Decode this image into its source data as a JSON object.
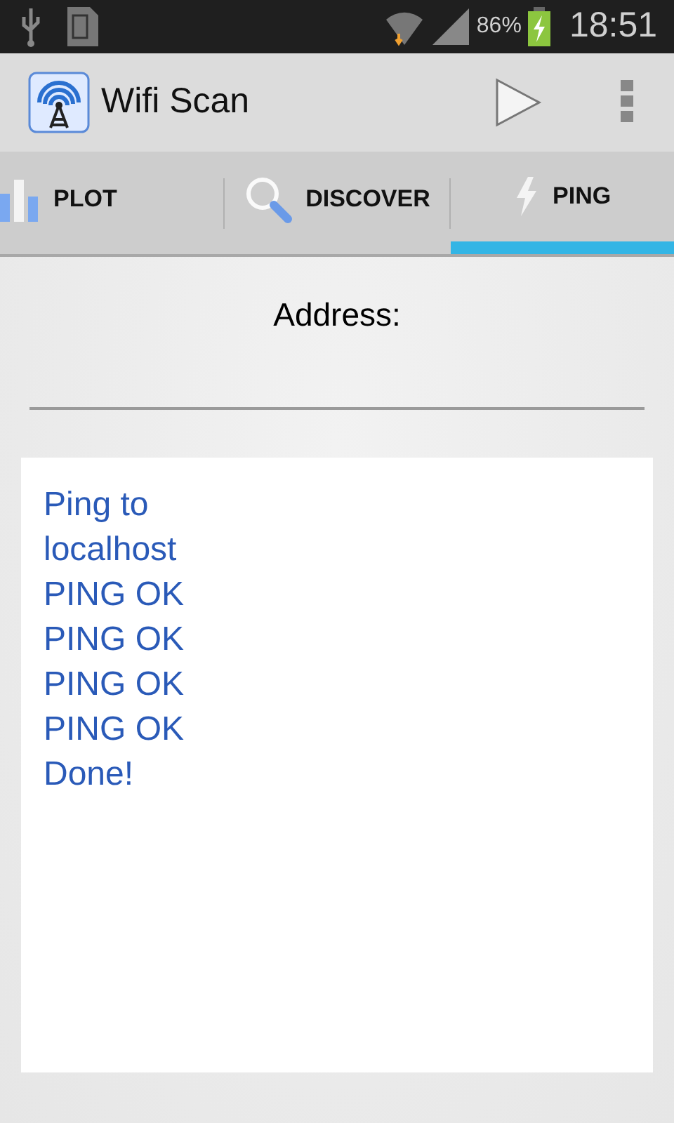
{
  "status_bar": {
    "battery": "86%",
    "time": "18:51"
  },
  "action_bar": {
    "title": "Wifi Scan"
  },
  "tabs": [
    {
      "label": "PLOT",
      "kind": "plot",
      "selected": false
    },
    {
      "label": "DISCOVER",
      "kind": "search",
      "selected": false
    },
    {
      "label": "PING",
      "kind": "bolt",
      "selected": true
    }
  ],
  "address": {
    "label": "Address:"
  },
  "output": [
    "Ping to",
    "localhost",
    "PING OK",
    "PING OK",
    "PING OK",
    "PING OK",
    "Done!"
  ]
}
